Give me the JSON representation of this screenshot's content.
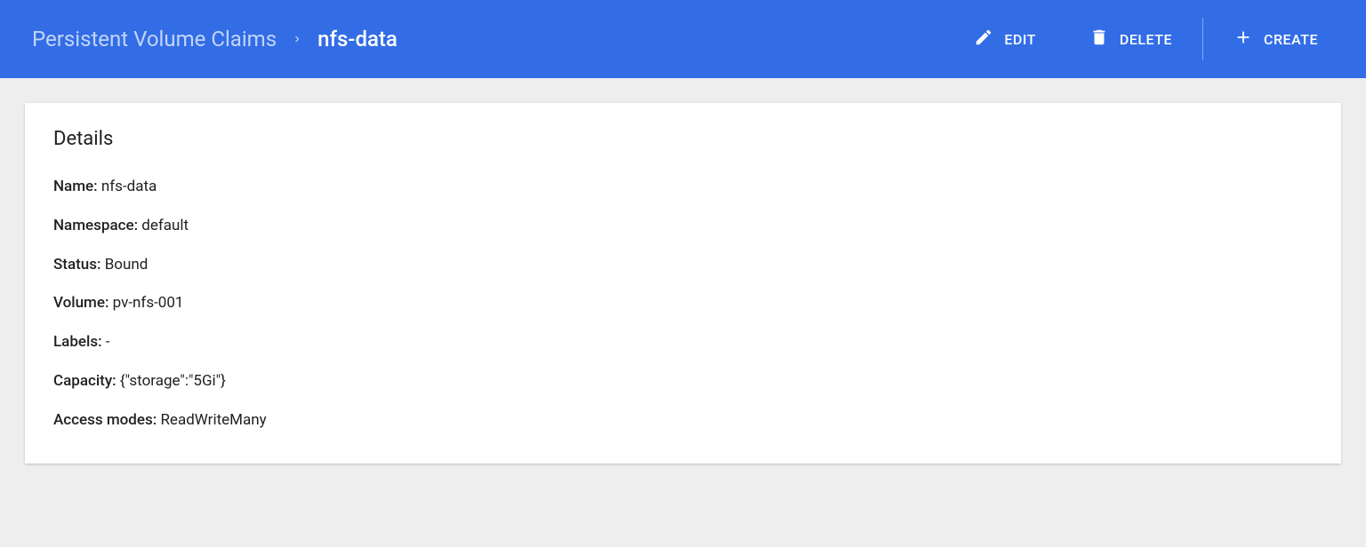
{
  "header": {
    "breadcrumb": {
      "parent": "Persistent Volume Claims",
      "current": "nfs-data"
    },
    "actions": {
      "edit": "EDIT",
      "delete": "DELETE",
      "create": "CREATE"
    }
  },
  "card": {
    "title": "Details",
    "rows": [
      {
        "label": "Name:",
        "value": "nfs-data"
      },
      {
        "label": "Namespace:",
        "value": "default"
      },
      {
        "label": "Status:",
        "value": "Bound"
      },
      {
        "label": "Volume:",
        "value": "pv-nfs-001"
      },
      {
        "label": "Labels:",
        "value": "-"
      },
      {
        "label": "Capacity:",
        "value": "{\"storage\":\"5Gi\"}"
      },
      {
        "label": "Access modes:",
        "value": "ReadWriteMany"
      }
    ]
  }
}
